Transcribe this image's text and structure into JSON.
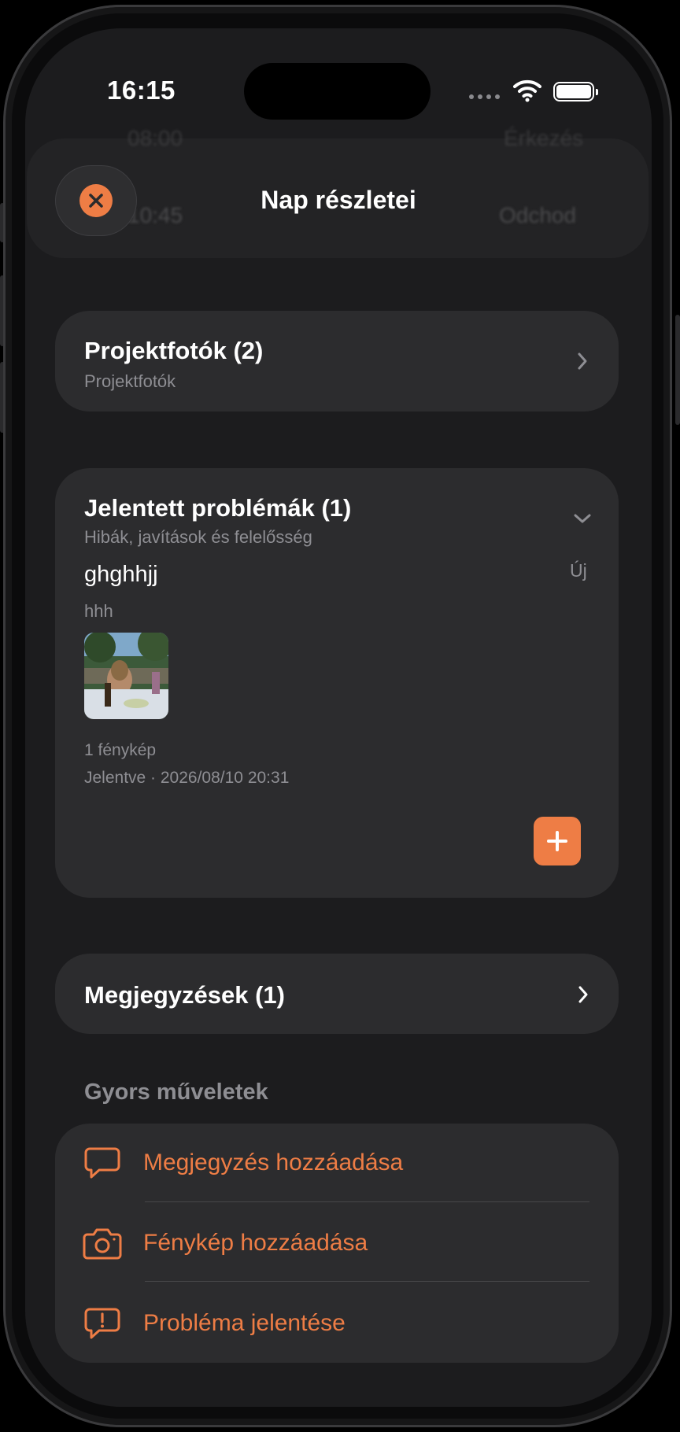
{
  "status_bar": {
    "time": "16:15"
  },
  "header": {
    "title": "Nap részletei",
    "behind_time_top": "08:00",
    "behind_label_top": "Érkezés",
    "behind_time": "10:45",
    "behind_label": "Odchod"
  },
  "photos_card": {
    "title": "Projektfotók (2)",
    "subtitle": "Projektfotók"
  },
  "issues_card": {
    "title": "Jelentett problémák (1)",
    "subtitle": "Hibák, javítások és felelősség",
    "issue": {
      "title": "ghghhjj",
      "status": "Új",
      "description": "hhh",
      "photo_count": "1 fénykép",
      "reported": "Jelentve · 2026/08/10 20:31"
    }
  },
  "notes_card": {
    "title": "Megjegyzések (1)"
  },
  "quick_actions": {
    "heading": "Gyors műveletek",
    "items": [
      {
        "label": "Megjegyzés hozzáadása",
        "icon": "chat-bubble-icon"
      },
      {
        "label": "Fénykép hozzáadása",
        "icon": "camera-icon"
      },
      {
        "label": "Probléma jelentése",
        "icon": "exclamation-bubble-icon"
      }
    ]
  },
  "colors": {
    "accent": "#ee7d45",
    "background": "#1c1c1e",
    "card": "#2c2c2e"
  }
}
